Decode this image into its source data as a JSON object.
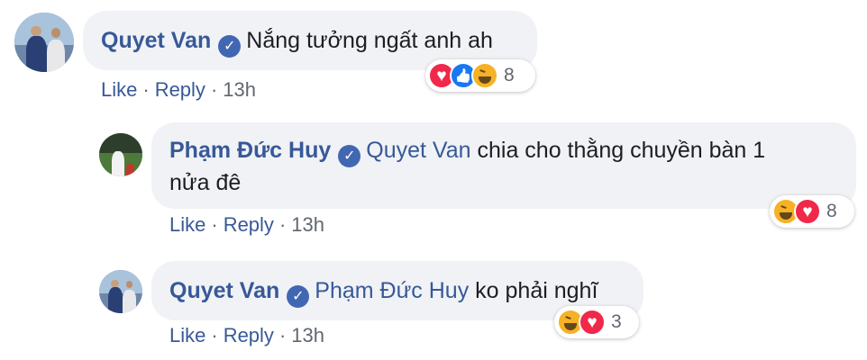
{
  "comments": [
    {
      "author": "Quyet Van",
      "text": "Nắng tưởng ngất anh ah",
      "like": "Like",
      "reply": "Reply",
      "time": "13h",
      "reactions": [
        "love",
        "like",
        "haha"
      ],
      "reaction_count": "8"
    },
    {
      "author": "Phạm Đức Huy",
      "mention": "Quyet Van",
      "text_line1": "chia cho thằng chuyền bàn 1",
      "text_line2": "nửa đê",
      "like": "Like",
      "reply": "Reply",
      "time": "13h",
      "reactions": [
        "haha",
        "love"
      ],
      "reaction_count": "8"
    },
    {
      "author": "Quyet Van",
      "mention": "Phạm Đức Huy",
      "text": "ko phải nghĩ",
      "like": "Like",
      "reply": "Reply",
      "time": "13h",
      "reactions": [
        "haha",
        "love"
      ],
      "reaction_count": "3"
    }
  ],
  "separator": "·",
  "verified_glyph": "✓",
  "colors": {
    "link": "#385898",
    "bubble": "#f0f2f5",
    "meta": "#606770",
    "verified": "#4267b2"
  }
}
